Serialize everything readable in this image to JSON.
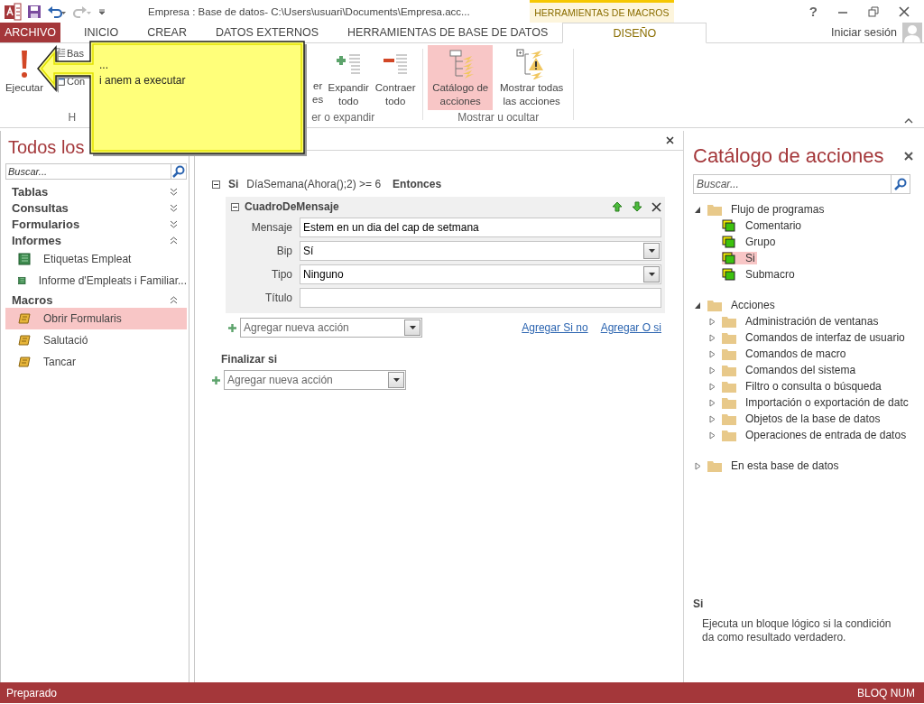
{
  "window": {
    "title": "Empresa : Base de datos- C:\\Users\\usuari\\Documents\\Empresa.acc...",
    "context_tab": "HERRAMIENTAS DE MACROS",
    "help": "?"
  },
  "tabs": [
    {
      "label": "ARCHIVO",
      "kind": "file",
      "selected": false
    },
    {
      "label": "INICIO",
      "kind": "plain",
      "selected": false
    },
    {
      "label": "CREAR",
      "kind": "plain",
      "selected": false
    },
    {
      "label": "DATOS EXTERNOS",
      "kind": "plain",
      "selected": false
    },
    {
      "label": "HERRAMIENTAS DE BASE DE DATOS",
      "kind": "plain",
      "selected": false
    },
    {
      "label": "DISEÑO",
      "kind": "context",
      "selected": true
    }
  ],
  "account": {
    "label": "Iniciar sesión"
  },
  "ribbon": {
    "groups": [
      {
        "label": "H",
        "buttons": [
          {
            "label": "Ejecutar",
            "kind": "run",
            "selected": false
          }
        ],
        "small_buttons": [
          {
            "label": "Bas",
            "kind": "step"
          },
          {
            "label": "Con",
            "kind": "convert"
          }
        ]
      },
      {
        "label": "er o expandir",
        "buttons": [
          {
            "label": "er es",
            "kind": "fragment",
            "selected": false
          },
          {
            "label": "Expandir todo",
            "kind": "expand",
            "selected": false
          },
          {
            "label": "Contraer todo",
            "kind": "collapse",
            "selected": false
          }
        ]
      },
      {
        "label": "Mostrar u ocultar",
        "buttons": [
          {
            "label": "Catálogo de acciones",
            "kind": "catalog",
            "selected": true
          },
          {
            "label": "Mostrar todas las acciones",
            "kind": "showall",
            "selected": false
          }
        ]
      }
    ]
  },
  "callout": {
    "lines": [
      "...",
      "i anem a executar"
    ]
  },
  "nav_pane": {
    "title": "Todos los",
    "search": {
      "placeholder": "Buscar..."
    },
    "groups": [
      {
        "label": "Tablas",
        "expanded": false
      },
      {
        "label": "Consultas",
        "expanded": false
      },
      {
        "label": "Formularios",
        "expanded": false
      },
      {
        "label": "Informes",
        "expanded": true,
        "items": [
          {
            "label": "Etiquetas Empleat",
            "kind": "report",
            "selected": false
          },
          {
            "label": "Informe d'Empleats i Familiar...",
            "kind": "report",
            "selected": false
          }
        ]
      },
      {
        "label": "Macros",
        "expanded": true,
        "items": [
          {
            "label": "Obrir Formularis",
            "kind": "macro",
            "selected": true
          },
          {
            "label": "Salutació",
            "kind": "macro",
            "selected": false
          },
          {
            "label": "Tancar",
            "kind": "macro",
            "selected": false
          }
        ]
      }
    ]
  },
  "macro": {
    "if_keyword": "Si",
    "condition": "DíaSemana(Ahora();2) >= 6",
    "then_keyword": "Entonces",
    "action": {
      "name": "CuadroDeMensaje",
      "expanded": true,
      "arguments": [
        {
          "label": "Mensaje",
          "kind": "text",
          "value": "Estem en un dia del cap de setmana"
        },
        {
          "label": "Bip",
          "kind": "dropdown",
          "value": "Sí"
        },
        {
          "label": "Tipo",
          "kind": "dropdown",
          "value": "Ninguno"
        },
        {
          "label": "Título",
          "kind": "text"
        }
      ]
    },
    "add_action": {
      "placeholder": "Agregar nueva acción"
    },
    "links": [
      "Agregar Si no",
      "Agregar O si"
    ],
    "end_keyword": "Finalizar si",
    "add_action_after": {
      "placeholder": "Agregar nueva acción"
    }
  },
  "catalog": {
    "title": "Catálogo de acciones",
    "search": {
      "placeholder": "Buscar..."
    },
    "tree": [
      {
        "label": "Flujo de programas",
        "kind": "folder",
        "expanded": true,
        "children": [
          {
            "label": "Comentario",
            "kind": "action",
            "selected": false
          },
          {
            "label": "Grupo",
            "kind": "action",
            "selected": false
          },
          {
            "label": "Si",
            "kind": "action",
            "selected": true
          },
          {
            "label": "Submacro",
            "kind": "action",
            "selected": false
          }
        ]
      },
      {
        "label": "Acciones",
        "kind": "folder",
        "expanded": true,
        "children": [
          {
            "label": "Administración de ventanas",
            "kind": "folder",
            "expanded": false
          },
          {
            "label": "Comandos de interfaz de usuario",
            "kind": "folder",
            "expanded": false
          },
          {
            "label": "Comandos de macro",
            "kind": "folder",
            "expanded": false
          },
          {
            "label": "Comandos del sistema",
            "kind": "folder",
            "expanded": false
          },
          {
            "label": "Filtro o consulta o búsqueda",
            "kind": "folder",
            "expanded": false
          },
          {
            "label": "Importación o exportación de datc",
            "kind": "folder",
            "expanded": false
          },
          {
            "label": "Objetos de la base de datos",
            "kind": "folder",
            "expanded": false
          },
          {
            "label": "Operaciones de entrada de datos",
            "kind": "folder",
            "expanded": false
          }
        ]
      },
      {
        "label": "En esta base de datos",
        "kind": "folder",
        "expanded": false
      }
    ],
    "info": {
      "title": "Si",
      "description": "Ejecuta un bloque lógico si la condición da como resultado verdadero."
    }
  },
  "status_bar": {
    "left": "Preparado",
    "right": "BLOQ NUM"
  }
}
